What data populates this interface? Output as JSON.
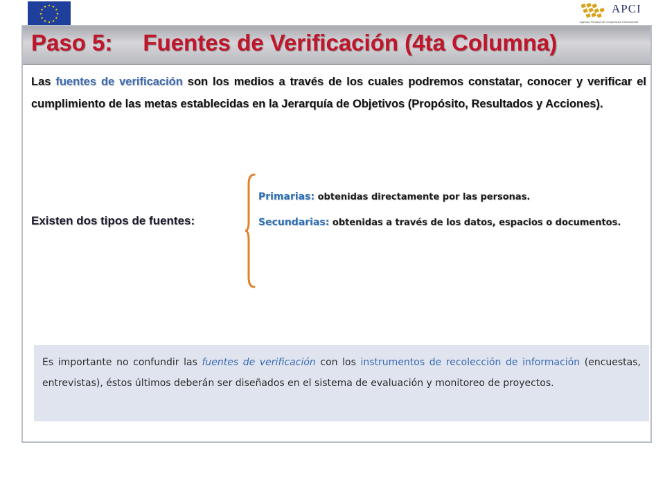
{
  "header": {
    "eu_flag": {
      "icon": "eu-flag-icon",
      "color": "#1f3f9c",
      "star_color": "#ffd700"
    },
    "apci_logo": {
      "text": "APCI",
      "subtitle": "Agencia Peruana de Cooperación Internacional",
      "icon": "apci-mark-icon"
    }
  },
  "slide": {
    "title_step": "Paso 5:",
    "title_main": "Fuentes de Verificación (4ta Columna)",
    "intro": {
      "before": "Las ",
      "highlight": "fuentes de verificación",
      "after": " son los medios a través de los cuales podremos constatar, conocer y verificar el cumplimiento de las metas establecidas en la Jerarquía de Objetivos (Propósito, Resultados y Acciones)."
    },
    "types_label": "Existen dos tipos de fuentes:",
    "types": [
      {
        "term": "Primarias:",
        "description": "obtenidas directamente por las personas."
      },
      {
        "term": "Secundarias:",
        "description": "obtenidas a través de los datos, espacios o documentos."
      }
    ],
    "note": {
      "part1": "Es importante no confundir las ",
      "em": "fuentes de verificación",
      "part2": " con los ",
      "highlight": "instrumentos de recolección de información",
      "part3": " (encuestas, entrevistas), éstos últimos deberán ser diseñados en el sistema de evaluación y monitoreo de proyectos."
    }
  },
  "colors": {
    "title": "#c0152b",
    "highlight": "#3a6ab0",
    "brace": "#e0822a",
    "note_background": "#dfe4ef"
  }
}
